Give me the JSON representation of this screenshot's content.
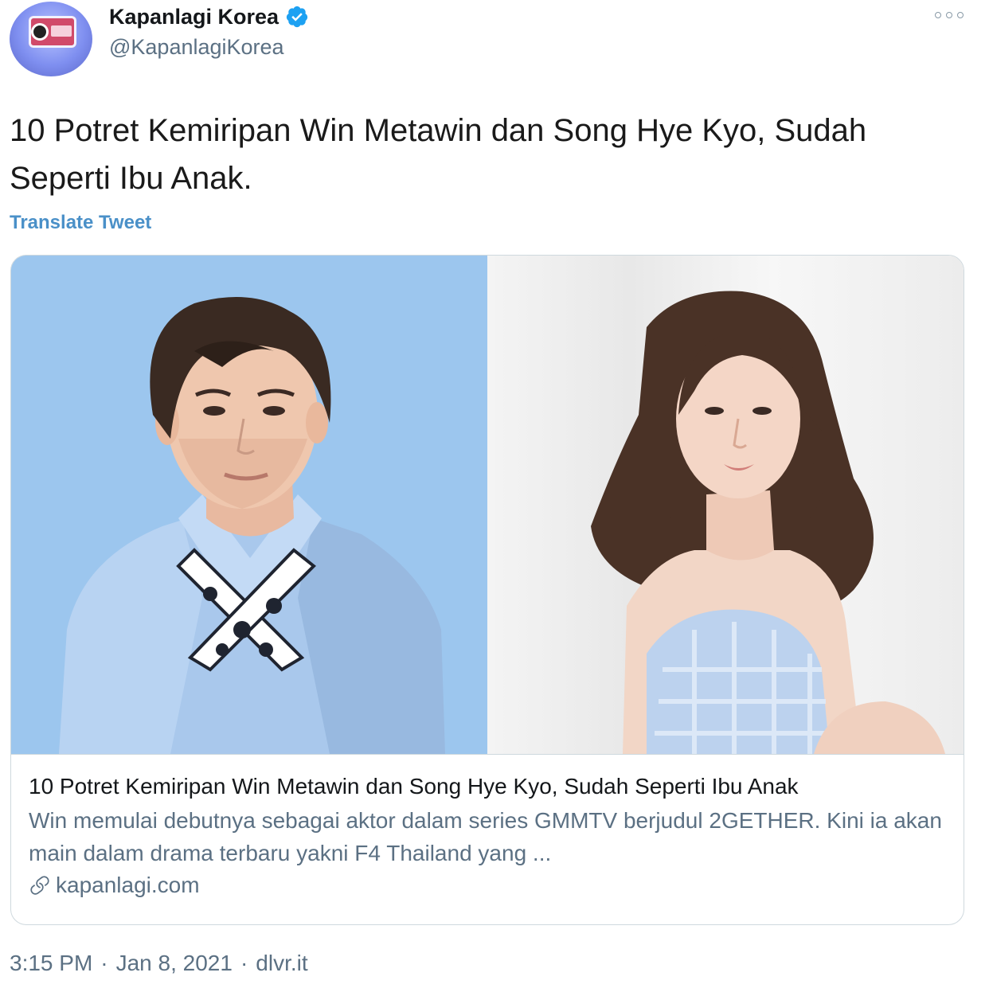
{
  "author": {
    "display_name": "Kapanlagi Korea",
    "handle": "@KapanlagiKorea",
    "verified": true,
    "avatar_icon": "retro-camera-logo",
    "accent_color": "#1da1f2"
  },
  "tweet": {
    "text": "10 Potret Kemiripan Win Metawin dan Song Hye Kyo, Sudah Seperti Ibu Anak.",
    "translate_label": "Translate Tweet"
  },
  "card": {
    "title": "10 Potret Kemiripan Win Metawin dan Song Hye Kyo, Sudah Seperti Ibu Anak",
    "description": "Win memulai debutnya sebagai aktor dalam series GMMTV berjudul 2GETHER. Kini ia akan main dalam drama terbaru yakni F4 Thailand yang ...",
    "domain": "kapanlagi.com",
    "link_icon": "link-icon",
    "image_left_bg": "#9cc6ee",
    "image_right_bg": "#f0f0f0"
  },
  "footer": {
    "time": "3:15 PM",
    "date": "Jan 8, 2021",
    "source": "dlvr.it",
    "separator": "·"
  },
  "more_icon": "more-options-icon"
}
